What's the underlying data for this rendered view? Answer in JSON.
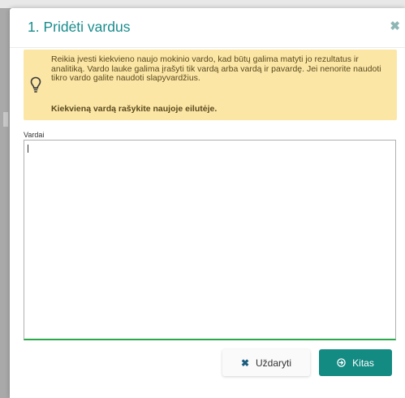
{
  "modal": {
    "title": "1. Pridėti vardus",
    "close_glyph": "✖",
    "close_icon": "close-icon"
  },
  "alert": {
    "icon": "lightbulb-icon",
    "text": "Reikia įvesti kiekvieno naujo mokinio vardo, kad būtų galima matyti jo rezultatus ir analitiką. Vardo lauke galima įrašyti tik vardą arba vardą ir pavardę. Jei nenorite naudoti tikro vardo galite naudoti slapyvardžius.",
    "strong_text": "Kiekvieną vardą rašykite naujoje eilutėje.",
    "background": "#fbe6a6"
  },
  "names_field": {
    "label": "Vardai",
    "value": ""
  },
  "footer": {
    "close_label": "Uždaryti",
    "close_glyph": "✖",
    "close_icon": "x-icon",
    "next_label": "Kitas",
    "next_icon": "arrow-circle-right-icon",
    "next_color": "#138a82"
  },
  "colors": {
    "title": "#1a8c8c",
    "textarea_focus_border": "#2aa84a"
  }
}
